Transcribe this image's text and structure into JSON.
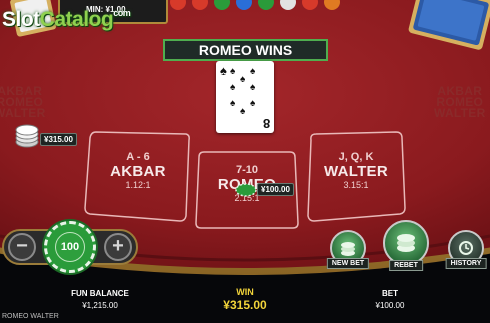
{
  "watermark": {
    "part1": "Slot",
    "part2": "Catalog",
    "tm": "com"
  },
  "limits": {
    "min_label": "MIN: ¥1.00"
  },
  "result": {
    "banner": "ROMEO WINS"
  },
  "card": {
    "rank": "8",
    "suit": "♠"
  },
  "side_brand": {
    "line1": "AKBAR",
    "line2": "ROMEO",
    "line3": "WALTER"
  },
  "side_stack": {
    "amount": "¥315.00"
  },
  "spots": [
    {
      "range": "A - 6",
      "name": "AKBAR",
      "payout": "1.12:1"
    },
    {
      "range": "7-10",
      "name": "ROMEO",
      "payout": "2.15:1"
    },
    {
      "range": "J, Q, K",
      "name": "WALTER",
      "payout": "3.15:1"
    }
  ],
  "spot_bet": {
    "amount": "¥100.00"
  },
  "controls": {
    "minus": "−",
    "plus": "+",
    "chip_value": "100"
  },
  "actions": {
    "new_bet": "NEW BET",
    "rebet": "REBET",
    "history": "HISTORY"
  },
  "footer": {
    "balance_label": "FUN BALANCE",
    "balance_value": "¥1,215.00",
    "win_label": "WIN",
    "win_value": "¥315.00",
    "bet_label": "BET",
    "bet_value": "¥100.00",
    "game_name": "ROMEO WALTER"
  },
  "colors": {
    "felt": "#8c1b1f",
    "rail": "#b08a3a",
    "chip_green": "#2a9b3a",
    "win_yellow": "#f2d43a",
    "banner_border": "#4fae4f"
  }
}
